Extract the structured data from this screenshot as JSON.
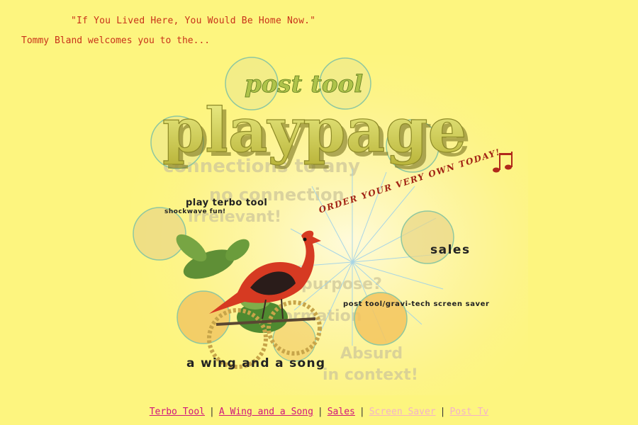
{
  "header": {
    "quote": "\"If You Lived Here, You Would Be Home Now.\"",
    "welcome": "Tommy Bland welcomes you to the..."
  },
  "logo": {
    "small_text": "post tool",
    "big_text": "playpage"
  },
  "background_text": [
    "connections to any",
    "no connection",
    "irrelevant!",
    "purpose?",
    "information",
    "Absurd",
    "in context!"
  ],
  "hotspots": {
    "terbo_title": "play terbo tool",
    "terbo_sub": "shockwave fun!",
    "sales": "sales",
    "screen_saver": "post tool/gravi-tech screen saver",
    "wing": "a wing and a song",
    "order": "ORDER YOUR VERY OWN TODAY!"
  },
  "nav": {
    "items": [
      "Terbo Tool",
      "A Wing and a Song",
      "Sales",
      "Screen Saver",
      "Post Tv"
    ],
    "separator": "|"
  },
  "colors": {
    "background": "#fdf57f",
    "header_text": "#c8321a",
    "link_active": "#d0157c",
    "link_visited": "#f4b2c9"
  }
}
